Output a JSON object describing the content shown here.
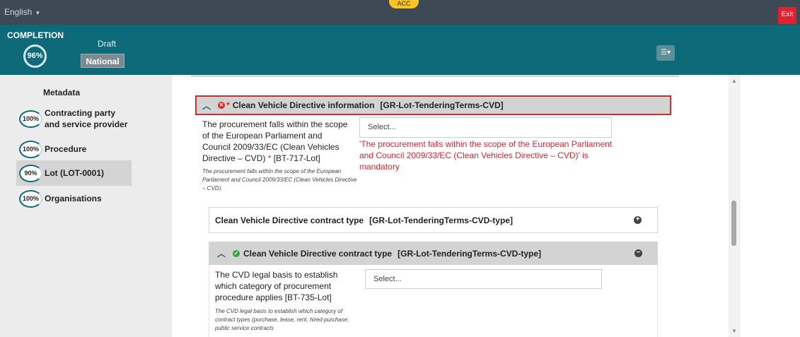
{
  "topbar": {
    "language": "English",
    "env_badge": "ACC",
    "exit_label": "Exit"
  },
  "header": {
    "completion_label": "COMPLETION",
    "completion_percent": "96%",
    "status": "Draft",
    "scope": "National"
  },
  "sidebar": {
    "metadata_label": "Metadata",
    "items": [
      {
        "percent": "100%",
        "label": "Contracting party and service provider"
      },
      {
        "percent": "100%",
        "label": "Procedure"
      },
      {
        "percent": "90%",
        "label": "Lot (LOT-0001)"
      },
      {
        "percent": "100%",
        "label": "Organisations"
      }
    ]
  },
  "section": {
    "title": "Clean Vehicle Directive information",
    "code": "[GR-Lot-TenderingTerms-CVD]",
    "field": {
      "label": "The procurement falls within the scope of the European Parliament and Council 2009/33/EC (Clean Vehicles Directive – CVD)",
      "bt": "[BT-717-Lot]",
      "help": "The procurement falls within the scope of the European Parliament and Council 2009/33/EC (Clean Vehicles Directive – CVD).",
      "placeholder": "Select...",
      "error": "'The procurement falls within the scope of the European Parliament and Council 2009/33/EC (Clean Vehicles Directive – CVD)' is mandatory"
    }
  },
  "subsections": {
    "collapsed": {
      "title": "Clean Vehicle Directive contract type",
      "code": "[GR-Lot-TenderingTerms-CVD-type]"
    },
    "expanded": {
      "title": "Clean Vehicle Directive contract type",
      "code": "[GR-Lot-TenderingTerms-CVD-type]",
      "field": {
        "label": "The CVD legal basis to establish which category of procurement procedure applies [BT-735-Lot]",
        "help": "The CVD legal basis to establish which category of contract types (purchase, lease, rent, hired-purchase, public service contracts",
        "placeholder": "Select..."
      }
    }
  },
  "colors": {
    "header": "#0e6a79",
    "topbar": "#3d4a55",
    "error": "#d32c2c",
    "ok": "#3aa53a",
    "exit": "#e0212f"
  }
}
